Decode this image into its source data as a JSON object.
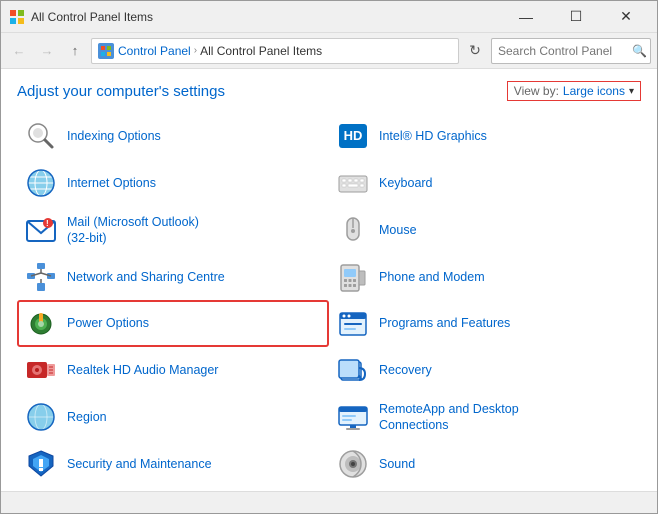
{
  "window": {
    "title": "All Control Panel Items",
    "icon": "⊞"
  },
  "titlebar": {
    "minimize": "—",
    "maximize": "☐",
    "close": "✕"
  },
  "addressbar": {
    "path_parts": [
      "Control Panel",
      "All Control Panel Items"
    ],
    "refresh_tooltip": "Refresh",
    "search_placeholder": "Search Control Panel"
  },
  "header": {
    "adjust_text": "Adjust your computer's settings",
    "viewby_label": "View by:",
    "viewby_value": "Large icons",
    "viewby_arrow": "▾"
  },
  "left_column": [
    {
      "id": "indexing-options",
      "label": "Indexing Options",
      "icon_type": "search-glass"
    },
    {
      "id": "internet-options",
      "label": "Internet Options",
      "icon_type": "globe"
    },
    {
      "id": "mail-outlook",
      "label": "Mail (Microsoft Outlook)\n(32-bit)",
      "icon_type": "mail"
    },
    {
      "id": "network-sharing",
      "label": "Network and Sharing Centre",
      "icon_type": "network",
      "highlighted": false
    },
    {
      "id": "power-options",
      "label": "Power Options",
      "icon_type": "power",
      "highlighted": true
    },
    {
      "id": "realtek-audio",
      "label": "Realtek HD Audio Manager",
      "icon_type": "audio"
    },
    {
      "id": "region",
      "label": "Region",
      "icon_type": "region-globe"
    },
    {
      "id": "security-maintenance",
      "label": "Security and Maintenance",
      "icon_type": "flag"
    }
  ],
  "right_column": [
    {
      "id": "intel-hd-graphics",
      "label": "Intel® HD Graphics",
      "icon_type": "intel"
    },
    {
      "id": "keyboard",
      "label": "Keyboard",
      "icon_type": "keyboard"
    },
    {
      "id": "mouse",
      "label": "Mouse",
      "icon_type": "mouse"
    },
    {
      "id": "phone-modem",
      "label": "Phone and Modem",
      "icon_type": "phone"
    },
    {
      "id": "programs-features",
      "label": "Programs and Features",
      "icon_type": "programs"
    },
    {
      "id": "recovery",
      "label": "Recovery",
      "icon_type": "recovery"
    },
    {
      "id": "remoteapp",
      "label": "RemoteApp and Desktop\nConnections",
      "icon_type": "remoteapp"
    },
    {
      "id": "sound",
      "label": "Sound",
      "icon_type": "sound"
    }
  ]
}
